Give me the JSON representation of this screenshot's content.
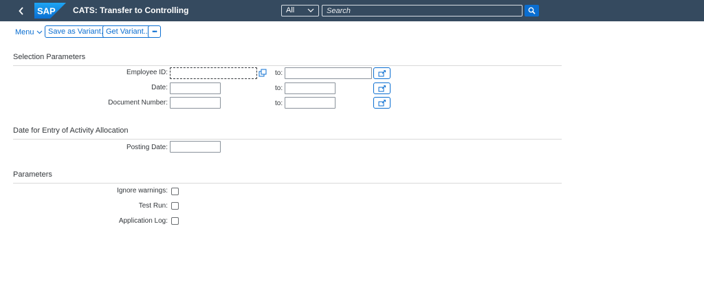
{
  "shell": {
    "title": "CATS: Transfer to Controlling",
    "logo_text": "SAP",
    "search_scope": "All",
    "search_placeholder": "Search",
    "colors": {
      "shell_bg": "#354a5f",
      "accent": "#0a6ed1"
    }
  },
  "toolbar": {
    "menu_label": "Menu",
    "save_variant_label": "Save as Variant...",
    "get_variant_label": "Get Variant...",
    "more_label": "•••"
  },
  "sections": {
    "selection": {
      "title": "Selection Parameters",
      "employee_id_label": "Employee ID:",
      "date_label": "Date:",
      "document_number_label": "Document Number:",
      "to_label": "to:"
    },
    "activity": {
      "title": "Date for Entry of Activity Allocation",
      "posting_date_label": "Posting Date:"
    },
    "parameters": {
      "title": "Parameters",
      "ignore_warnings_label": "Ignore warnings:",
      "test_run_label": "Test Run:",
      "application_log_label": "Application Log:"
    }
  }
}
